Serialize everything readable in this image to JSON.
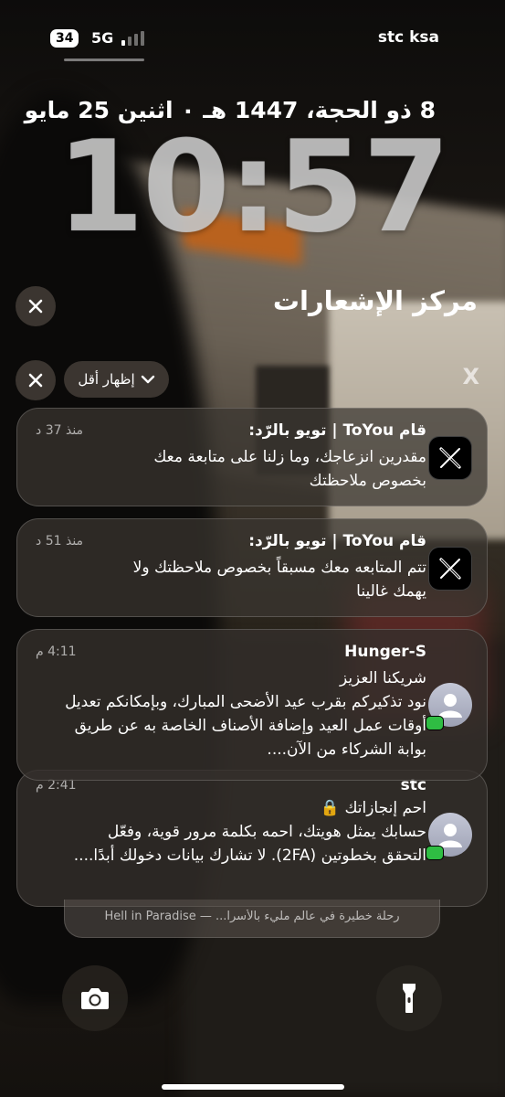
{
  "status_bar": {
    "battery": "34",
    "network": "5G",
    "carrier": "stc ksa"
  },
  "lock_screen": {
    "date": "8 ذو الحجة، 1447 هـ ٠ اثنين 25 مايو",
    "time": "10:57"
  },
  "notification_center": {
    "title": "مركز الإشعارات",
    "show_less_label": "إظهار أقل",
    "group_app_label": "X"
  },
  "notifications": [
    {
      "sender": "قام ToYou | تويو بالرّد:",
      "time": "منذ 37 د",
      "body_lines": [
        "مقدرين انزعاجك، وما زلنا على متابعة معك",
        "بخصوص ملاحظتك"
      ],
      "app_icon": "x-logo-icon"
    },
    {
      "sender": "قام ToYou | تويو بالرّد:",
      "time": "منذ 51 د",
      "body_lines": [
        "تتم المتابعه معك مسبقاً بخصوص ملاحظتك ولا",
        "يهمك غالينا"
      ],
      "app_icon": "x-logo-icon"
    },
    {
      "sender": "Hunger-S",
      "time": "4:11 م",
      "body_lines": [
        "شريكنا العزيز",
        "نود تذكيركم بقرب عيد الأضحى المبارك، وبإمكانكم تعديل",
        "أوقات عمل العيد وإضافة الأصناف الخاصة به عن طريق",
        "بوابة الشركاء من الآن...."
      ],
      "app_icon": "contact-avatar-icon"
    },
    {
      "sender": "stc",
      "time": "2:41 م",
      "body_lines": [
        "احم إنجازاتك 🔒",
        "",
        "حسابك يمثل هويتك، احمه بكلمة مرور قوية، وفعّل",
        "التحقق بخطوتين (2FA). لا تشارك بيانات دخولك أبدًا...."
      ],
      "app_icon": "contact-avatar-icon"
    }
  ],
  "stacked_preview": "رحلة خطيرة في عالم مليء بالأسرا... — Hell in Paradise",
  "controls": {
    "left": "camera-icon",
    "right": "flashlight-icon"
  }
}
